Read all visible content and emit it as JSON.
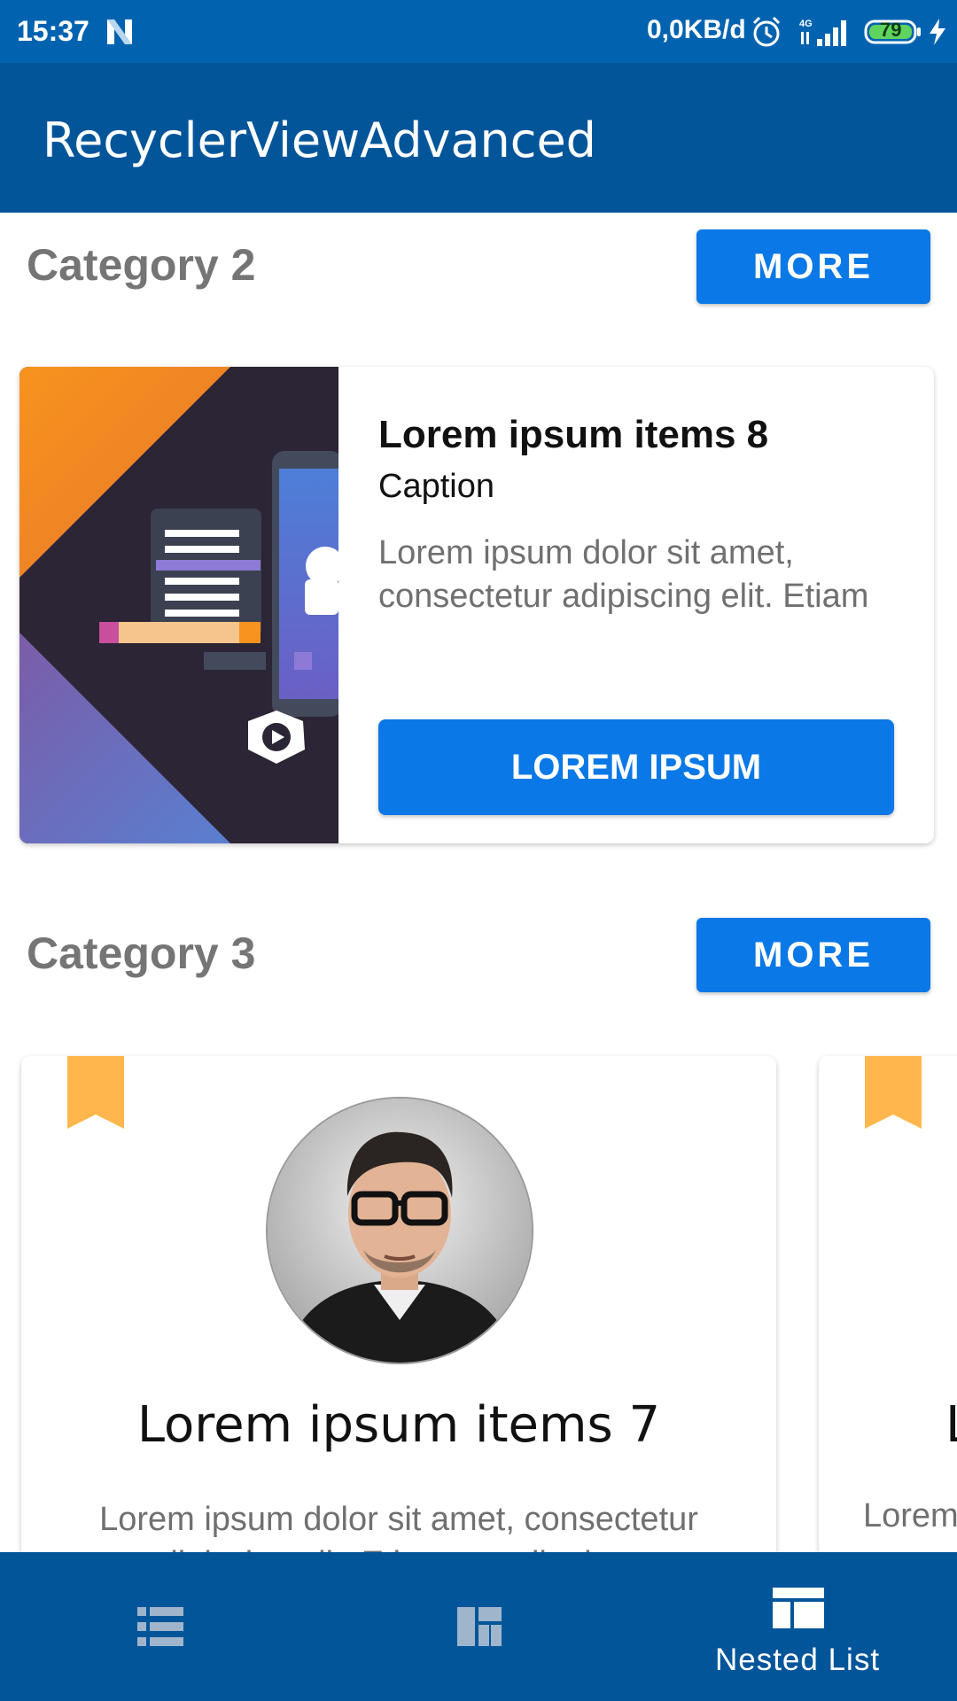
{
  "status_bar": {
    "time": "15:37",
    "network_speed": "0,0KB/d",
    "network_type": "4G",
    "battery_level": "79",
    "icons": [
      "notification-n-icon",
      "alarm-icon",
      "signal-icon",
      "battery-icon",
      "charging-icon"
    ]
  },
  "app_bar": {
    "title": "RecyclerViewAdvanced"
  },
  "categories": [
    {
      "title": "Category 2",
      "more_label": "MORE",
      "card": {
        "title": "Lorem ipsum items 8",
        "caption": "Caption",
        "description": "Lorem ipsum dolor sit amet, consectetur adipiscing elit. Etiam eget ligula eu lectus lo...",
        "button_label": "LOREM IPSUM",
        "image": "android-illustration"
      }
    },
    {
      "title": "Category 3",
      "more_label": "MORE",
      "cards": [
        {
          "title": "Lorem ipsum items 7",
          "description": "Lorem ipsum dolor sit amet, consectetur adipiscing elit. Etiam eget ligula eu",
          "image": "man-with-glasses-avatar",
          "icon": "bookmark-icon"
        },
        {
          "title": "L",
          "description": "Lorem"
        }
      ]
    }
  ],
  "bottom_nav": {
    "items": [
      {
        "icon": "list-icon",
        "label": ""
      },
      {
        "icon": "dashboard-icon",
        "label": ""
      },
      {
        "icon": "nested-list-icon",
        "label": "Nested List",
        "selected": true
      }
    ]
  },
  "colors": {
    "status_bar": "#0163b0",
    "app_bar": "#03559a",
    "accent_button": "#0a78e6",
    "bookmark": "#ffb74d",
    "category_title": "#757575"
  }
}
